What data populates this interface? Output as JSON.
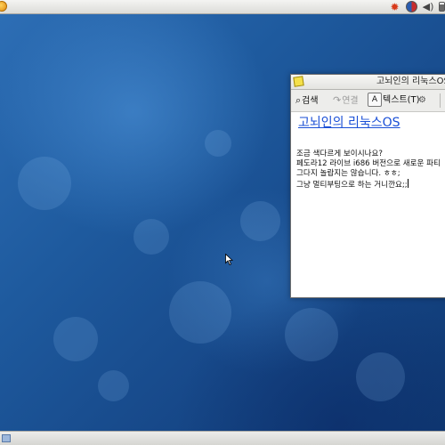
{
  "top_panel": {
    "menu_icon": "distro-logo-icon",
    "tray": [
      "alert-icon",
      "input-method-icon",
      "volume-icon",
      "battery-icon"
    ]
  },
  "window": {
    "title": "고뇌인의 리눅스OS",
    "toolbar": {
      "search_label": "검색",
      "links_label": "연결",
      "text_label": "텍스트(T)",
      "settings_icon": "gears-icon"
    },
    "note_title": "고뇌인의 리눅스OS",
    "note_lines": [
      "조금 색다르게 보이시나요?",
      "페도라12 라이브 i686 버전으로 새로운 파티",
      "그다지 놀랍지는 않습니다. ㅎㅎ;",
      "그냥 멀티부팅으로 하는 거니깐요;;"
    ]
  },
  "colors": {
    "wallpaper": "#1e5a9e",
    "link": "#1a4fd6",
    "panel": "#e6e6e2"
  }
}
